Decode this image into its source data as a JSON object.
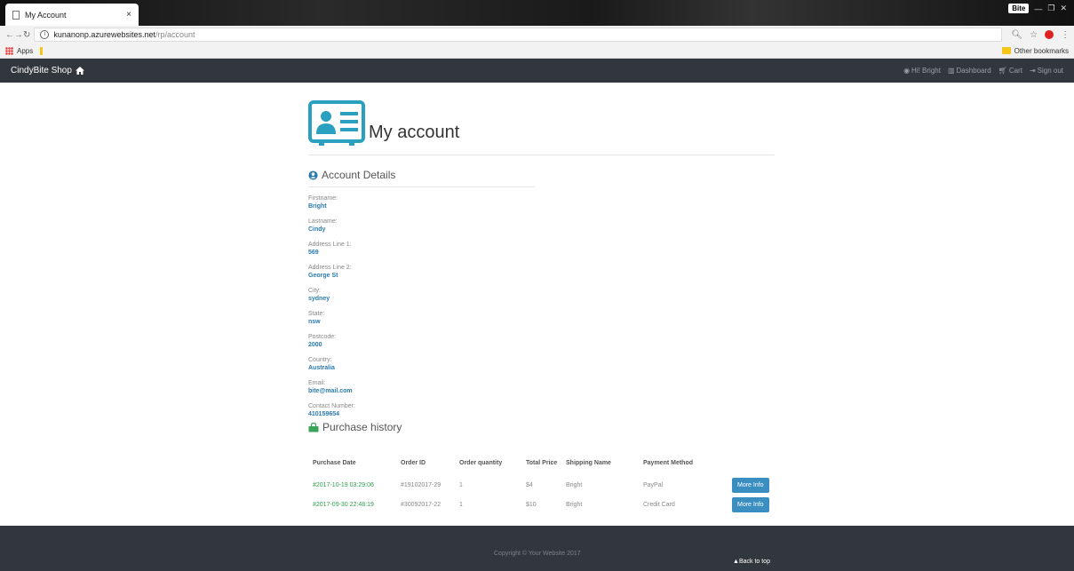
{
  "browser": {
    "tab_title": "My Account",
    "tab_close": "×",
    "profile_label": "Bite",
    "url_host": "kunanonp.azurewebsites.net",
    "url_path": "/rp/account",
    "bookmark_apps": "Apps",
    "bookmark_other": "Other bookmarks"
  },
  "navbar": {
    "brand": "CindyBite Shop",
    "greeting": "Hi! Bright",
    "dashboard": "Dashboard",
    "cart": "Cart",
    "signout": "Sign out"
  },
  "page": {
    "title": "My account",
    "details_heading": "Account Details",
    "purchase_heading": "Purchase history"
  },
  "account": {
    "firstname_label": "Firstname:",
    "firstname": "Bright",
    "lastname_label": "Lastname:",
    "lastname": "Cindy",
    "addr1_label": "Address Line 1:",
    "addr1": "569",
    "addr2_label": "Address Line 2:",
    "addr2": "George St",
    "city_label": "City:",
    "city": "sydney",
    "state_label": "State:",
    "state": "nsw",
    "postcode_label": "Postcode:",
    "postcode": "2000",
    "country_label": "Country:",
    "country": "Australia",
    "email_label": "Email:",
    "email": "bite@mail.com",
    "contact_label": "Contact Number:",
    "contact": "410159654"
  },
  "orders": {
    "headers": [
      "Purchase Date",
      "Order ID",
      "Order quantity",
      "Total Price",
      "Shipping Name",
      "Payment Method"
    ],
    "rows": [
      {
        "date": "#2017-10-19 03:29:06",
        "id": "#19102017-29",
        "qty": "1",
        "price": "$4",
        "name": "Bright",
        "method": "PayPal",
        "button": "More Info"
      },
      {
        "date": "#2017-09-30 22:48:19",
        "id": "#30092017-22",
        "qty": "1",
        "price": "$10",
        "name": "Bright",
        "method": "Credit Card",
        "button": "More Info"
      }
    ]
  },
  "footer": {
    "copyright": "Copyright © Your Website 2017",
    "back_to_top": "Back to top"
  },
  "colors": {
    "navbar": "#32373d",
    "link_blue": "#2a7ab0",
    "date_green": "#2e9e4c",
    "button_blue": "#3a8fc0",
    "icon_teal": "#2aa0c0",
    "bag_green": "#3aa55a"
  }
}
